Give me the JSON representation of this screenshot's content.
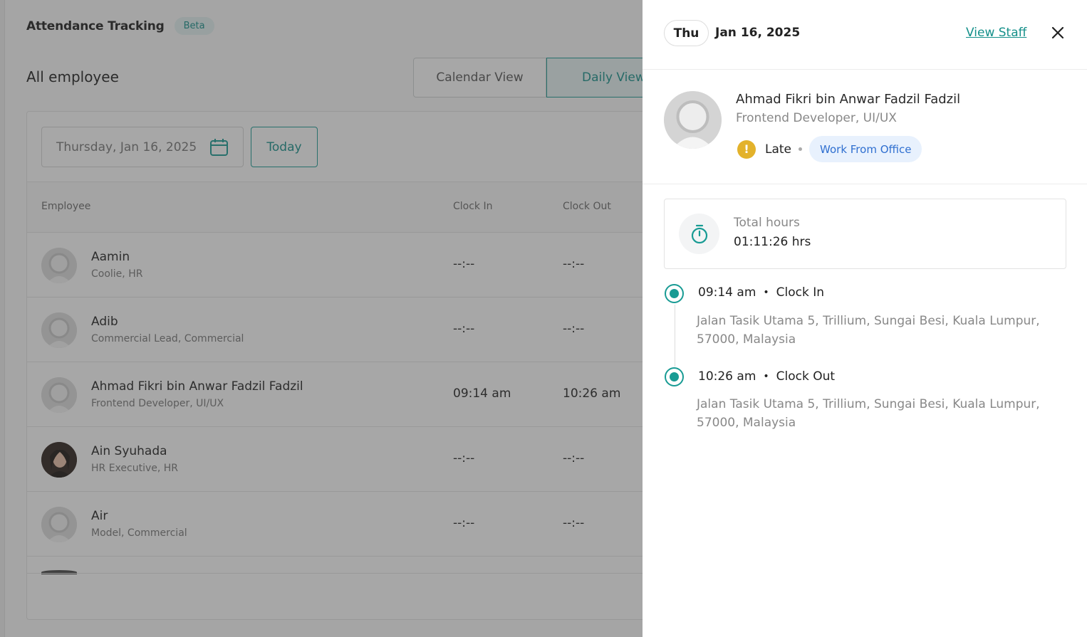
{
  "page": {
    "title": "Attendance Tracking",
    "badge": "Beta",
    "section_title": "All employee",
    "views": {
      "calendar": "Calendar View",
      "daily": "Daily View"
    },
    "date_value": "Thursday, Jan 16, 2025",
    "today_label": "Today",
    "columns": {
      "employee": "Employee",
      "clock_in": "Clock In",
      "clock_out": "Clock Out"
    },
    "rows": [
      {
        "name": "Aamin",
        "role": "Coolie, HR",
        "clock_in": "--:--",
        "clock_out": "--:--"
      },
      {
        "name": "Adib",
        "role": "Commercial Lead, Commercial",
        "clock_in": "--:--",
        "clock_out": "--:--"
      },
      {
        "name": "Ahmad Fikri bin Anwar Fadzil Fadzil",
        "role": "Frontend Developer, UI/UX",
        "clock_in": "09:14 am",
        "clock_out": "10:26 am"
      },
      {
        "name": "Ain Syuhada",
        "role": "HR Executive, HR",
        "clock_in": "--:--",
        "clock_out": "--:--"
      },
      {
        "name": "Air",
        "role": "Model, Commercial",
        "clock_in": "--:--",
        "clock_out": "--:--"
      }
    ]
  },
  "drawer": {
    "day": "Thu",
    "date": "Jan 16, 2025",
    "view_staff": "View Staff",
    "employee_name": "Ahmad Fikri bin Anwar Fadzil Fadzil",
    "employee_role": "Frontend Developer, UI/UX",
    "status": "Late",
    "status_icon": "!",
    "work_mode": "Work From Office",
    "total_hours_label": "Total hours",
    "total_hours_value": "01:11:26 hrs",
    "events": [
      {
        "time": "09:14 am",
        "separator": "•",
        "type": "Clock In",
        "address": "Jalan Tasik Utama 5, Trillium, Sungai Besi, Kuala Lumpur, 57000, Malaysia"
      },
      {
        "time": "10:26 am",
        "separator": "•",
        "type": "Clock Out",
        "address": "Jalan Tasik Utama 5, Trillium, Sungai Besi, Kuala Lumpur, 57000, Malaysia"
      }
    ]
  },
  "colors": {
    "accent": "#189b94",
    "warning": "#e3b22b",
    "badge_blue": "#2f6fd0"
  },
  "icons": [
    "calendar-icon",
    "close-icon",
    "stopwatch-icon",
    "warning-icon",
    "avatar-placeholder-icon"
  ]
}
